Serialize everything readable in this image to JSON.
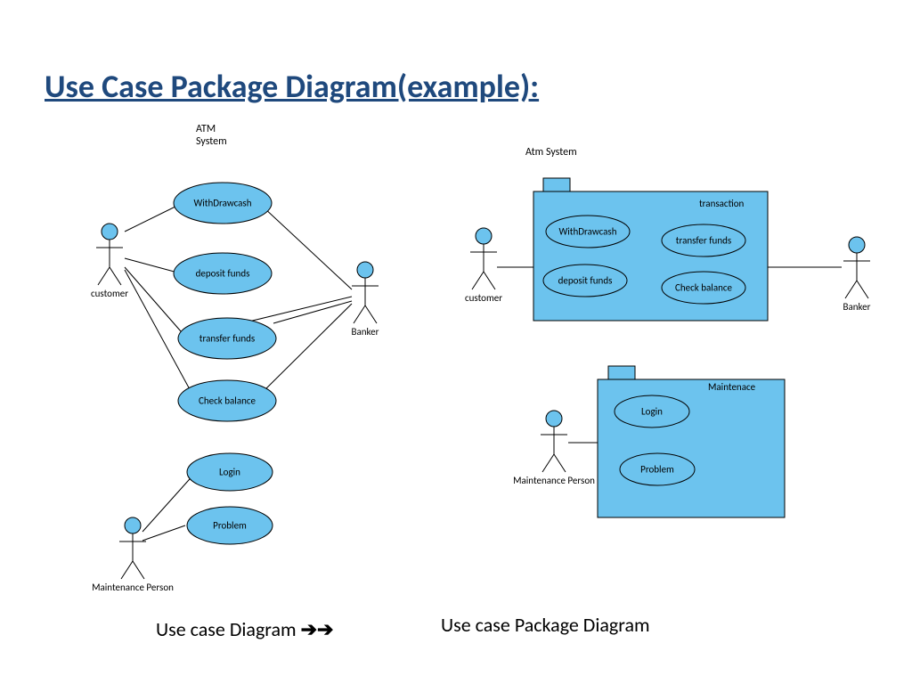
{
  "title": "Use Case Package Diagram(example):",
  "left_diagram": {
    "system_label_line1": "ATM",
    "system_label_line2": "System",
    "actors": {
      "customer": "customer",
      "banker": "Banker",
      "maintenance": "Maintenance Person"
    },
    "usecases": {
      "withdraw": "WithDrawcash",
      "deposit": "deposit funds",
      "transfer": "transfer funds",
      "check": "Check balance",
      "login": "Login",
      "problem": "Problem"
    }
  },
  "right_diagram": {
    "system_label": "Atm System",
    "packages": {
      "transaction": "transaction",
      "maintenance": "Maintenace"
    },
    "actors": {
      "customer": "customer",
      "banker": "Banker",
      "maintenance": "Maintenance Person"
    },
    "usecases": {
      "withdraw": "WithDrawcash",
      "deposit": "deposit funds",
      "transfer": "transfer funds",
      "check": "Check balance",
      "login": "Login",
      "problem": "Problem"
    }
  },
  "captions": {
    "left": "Use case Diagram",
    "arrows": "➔➔",
    "right": "Use case Package  Diagram"
  },
  "colors": {
    "ellipse_fill": "#6cc3ee",
    "package_fill": "#6cc3ee",
    "actor_head": "#6cc3ee",
    "stroke": "#000000",
    "title": "#1f497d"
  }
}
